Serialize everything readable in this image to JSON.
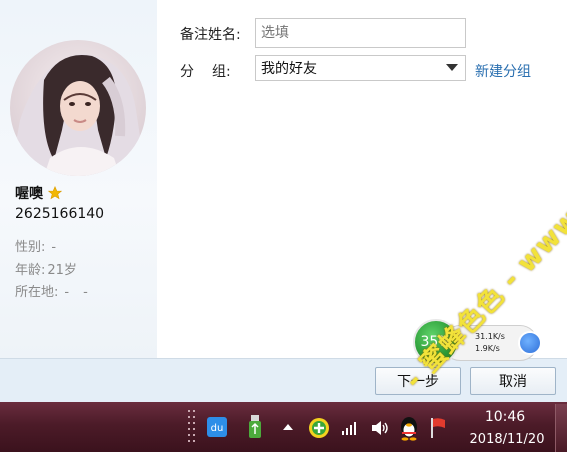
{
  "profile": {
    "nickname": "喔噢",
    "qq_number": "2625166140",
    "gender_label": "性别:",
    "gender_value": "-",
    "age_label": "年龄:",
    "age_value": "21岁",
    "location_label": "所在地:",
    "location_value_1": "-",
    "location_value_2": "-"
  },
  "form": {
    "remark_label": "备注姓名:",
    "remark_placeholder": "选填",
    "group_label_1": "分",
    "group_label_2": "组:",
    "group_value": "我的好友",
    "new_group_link": "新建分组"
  },
  "buttons": {
    "next_label": "下一步",
    "cancel_label": "取消"
  },
  "net_widget": {
    "percent": "35%",
    "up_speed": "31.1K/s",
    "down_speed": "1.9K/s"
  },
  "taskbar": {
    "time": "10:46",
    "date": "2018/11/20",
    "tray_icons": [
      "baidu-du-icon",
      "usb-drive-icon",
      "show-hidden-arrow-icon",
      "360-guard-icon",
      "network-signal-icon",
      "volume-icon",
      "qq-penguin-icon",
      "security-flag-icon"
    ]
  },
  "watermark": {
    "text": "- 蜜蜂色色 - www.MFsese.com"
  },
  "colors": {
    "link": "#2a6fb0",
    "taskbar": "#4c1b28",
    "star": "#f2b705",
    "widget_green": "#2a9a36",
    "watermark": "#f2e23a"
  }
}
